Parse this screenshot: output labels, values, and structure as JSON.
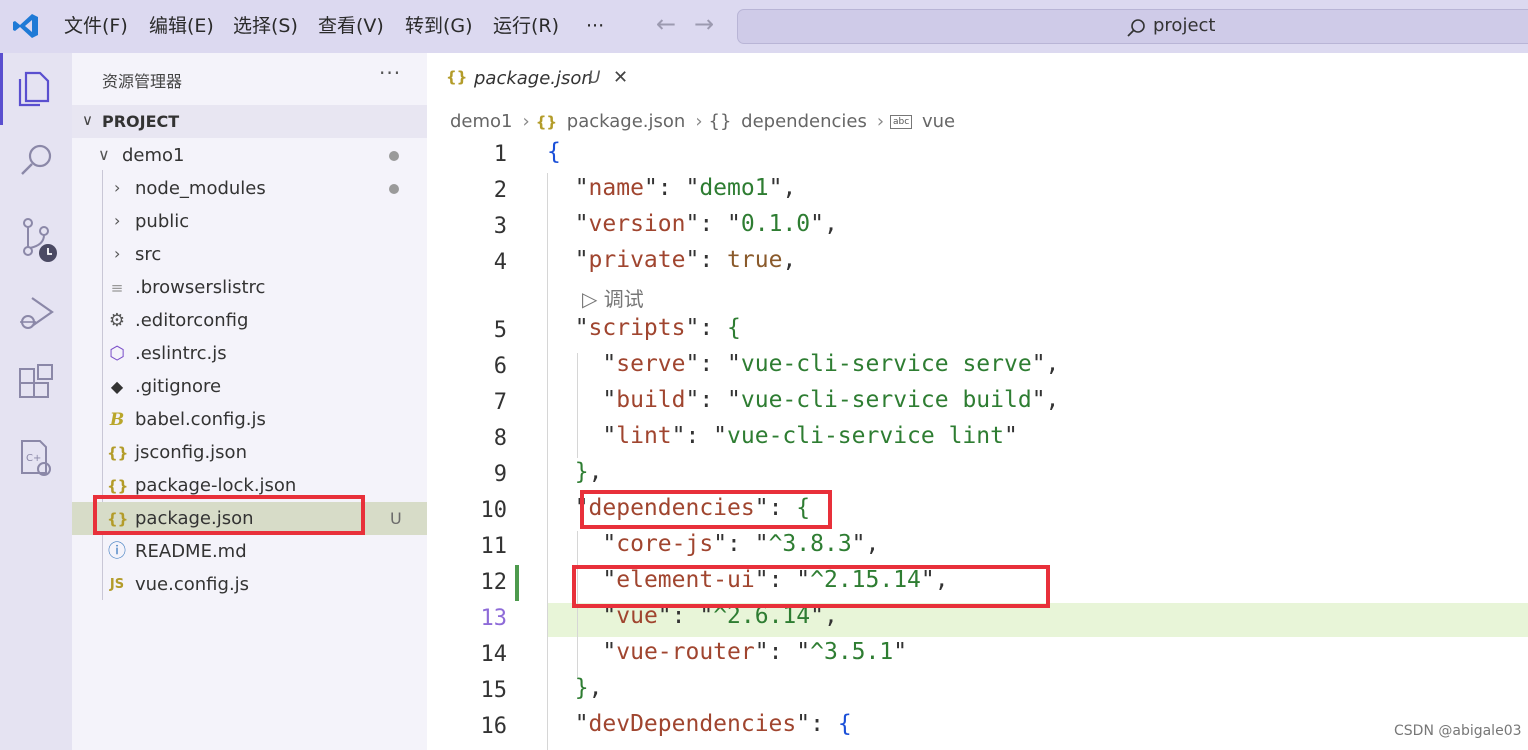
{
  "menu": {
    "items": [
      "文件(F)",
      "编辑(E)",
      "选择(S)",
      "查看(V)",
      "转到(G)",
      "运行(R)"
    ],
    "more": "···"
  },
  "search": {
    "text": "project"
  },
  "explorer": {
    "title": "资源管理器",
    "more": "···",
    "section": "PROJECT",
    "tree": [
      {
        "name": "demo1",
        "kind": "folder-open",
        "depth": 1,
        "dot": true
      },
      {
        "name": "node_modules",
        "kind": "folder",
        "depth": 2,
        "dot": true
      },
      {
        "name": "public",
        "kind": "folder",
        "depth": 2
      },
      {
        "name": "src",
        "kind": "folder",
        "depth": 2
      },
      {
        "name": ".browserslistrc",
        "kind": "lines-icon",
        "depth": 2
      },
      {
        "name": ".editorconfig",
        "kind": "gear-icon",
        "depth": 2
      },
      {
        "name": ".eslintrc.js",
        "kind": "eslint-icon",
        "depth": 2
      },
      {
        "name": ".gitignore",
        "kind": "git-icon",
        "depth": 2
      },
      {
        "name": "babel.config.js",
        "kind": "babel-icon",
        "depth": 2
      },
      {
        "name": "jsconfig.json",
        "kind": "json-icon",
        "depth": 2
      },
      {
        "name": "package-lock.json",
        "kind": "json-icon",
        "depth": 2
      },
      {
        "name": "package.json",
        "kind": "json-icon",
        "depth": 2,
        "selected": true,
        "badge": "U"
      },
      {
        "name": "README.md",
        "kind": "info-icon",
        "depth": 2
      },
      {
        "name": "vue.config.js",
        "kind": "js-icon",
        "depth": 2
      }
    ]
  },
  "tab": {
    "icon": "{}",
    "name": "package.json",
    "status": "U",
    "close": "✕"
  },
  "breadcrumb": {
    "parts": [
      "demo1",
      "package.json",
      "dependencies",
      "vue"
    ],
    "json_icon": "{}",
    "obj_icon": "{}",
    "str_icon": "abc"
  },
  "editor": {
    "codelens": "调试",
    "current_line": 13,
    "lines": [
      {
        "n": "1",
        "tokens": [
          [
            "b",
            "{"
          ]
        ]
      },
      {
        "n": "2",
        "tokens": [
          [
            "p",
            "  \""
          ],
          [
            "k",
            "name"
          ],
          [
            "p",
            "\": \""
          ],
          [
            "s",
            "demo1"
          ],
          [
            "p",
            "\","
          ]
        ]
      },
      {
        "n": "3",
        "tokens": [
          [
            "p",
            "  \""
          ],
          [
            "k",
            "version"
          ],
          [
            "p",
            "\": \""
          ],
          [
            "s",
            "0.1.0"
          ],
          [
            "p",
            "\","
          ]
        ]
      },
      {
        "n": "4",
        "tokens": [
          [
            "p",
            "  \""
          ],
          [
            "k",
            "private"
          ],
          [
            "p",
            "\": "
          ],
          [
            "n",
            "true"
          ],
          [
            "p",
            ","
          ]
        ]
      },
      {
        "n": "5",
        "tokens": [
          [
            "p",
            "  \""
          ],
          [
            "k",
            "scripts"
          ],
          [
            "p",
            "\": "
          ],
          [
            "s",
            "{"
          ]
        ]
      },
      {
        "n": "6",
        "tokens": [
          [
            "p",
            "    \""
          ],
          [
            "k",
            "serve"
          ],
          [
            "p",
            "\": \""
          ],
          [
            "s",
            "vue-cli-service serve"
          ],
          [
            "p",
            "\","
          ]
        ]
      },
      {
        "n": "7",
        "tokens": [
          [
            "p",
            "    \""
          ],
          [
            "k",
            "build"
          ],
          [
            "p",
            "\": \""
          ],
          [
            "s",
            "vue-cli-service build"
          ],
          [
            "p",
            "\","
          ]
        ]
      },
      {
        "n": "8",
        "tokens": [
          [
            "p",
            "    \""
          ],
          [
            "k",
            "lint"
          ],
          [
            "p",
            "\": \""
          ],
          [
            "s",
            "vue-cli-service lint"
          ],
          [
            "p",
            "\""
          ]
        ]
      },
      {
        "n": "9",
        "tokens": [
          [
            "p",
            "  "
          ],
          [
            "s",
            "}"
          ],
          [
            "p",
            ","
          ]
        ]
      },
      {
        "n": "10",
        "tokens": [
          [
            "p",
            "  \""
          ],
          [
            "k",
            "dependencies"
          ],
          [
            "p",
            "\": "
          ],
          [
            "s",
            "{"
          ]
        ]
      },
      {
        "n": "11",
        "tokens": [
          [
            "p",
            "    \""
          ],
          [
            "k",
            "core-js"
          ],
          [
            "p",
            "\": \""
          ],
          [
            "s",
            "^3.8.3"
          ],
          [
            "p",
            "\","
          ]
        ]
      },
      {
        "n": "12",
        "tokens": [
          [
            "p",
            "    \""
          ],
          [
            "k",
            "element-ui"
          ],
          [
            "p",
            "\": \""
          ],
          [
            "s",
            "^2.15.14"
          ],
          [
            "p",
            "\","
          ]
        ]
      },
      {
        "n": "13",
        "tokens": [
          [
            "p",
            "    \""
          ],
          [
            "k",
            "vue"
          ],
          [
            "p",
            "\": \""
          ],
          [
            "s",
            "^2.6.14"
          ],
          [
            "p",
            "\","
          ]
        ]
      },
      {
        "n": "14",
        "tokens": [
          [
            "p",
            "    \""
          ],
          [
            "k",
            "vue-router"
          ],
          [
            "p",
            "\": \""
          ],
          [
            "s",
            "^3.5.1"
          ],
          [
            "p",
            "\""
          ]
        ]
      },
      {
        "n": "15",
        "tokens": [
          [
            "p",
            "  "
          ],
          [
            "s",
            "}"
          ],
          [
            "p",
            ","
          ]
        ]
      },
      {
        "n": "16",
        "tokens": [
          [
            "p",
            "  \""
          ],
          [
            "k",
            "devDependencies"
          ],
          [
            "p",
            "\": "
          ],
          [
            "b",
            "{"
          ]
        ]
      }
    ]
  },
  "watermark": "CSDN @abigale03",
  "colors": {
    "accent": "#5a4fcf",
    "highlight": "#e8303a",
    "selection": "#d7dcc8"
  }
}
